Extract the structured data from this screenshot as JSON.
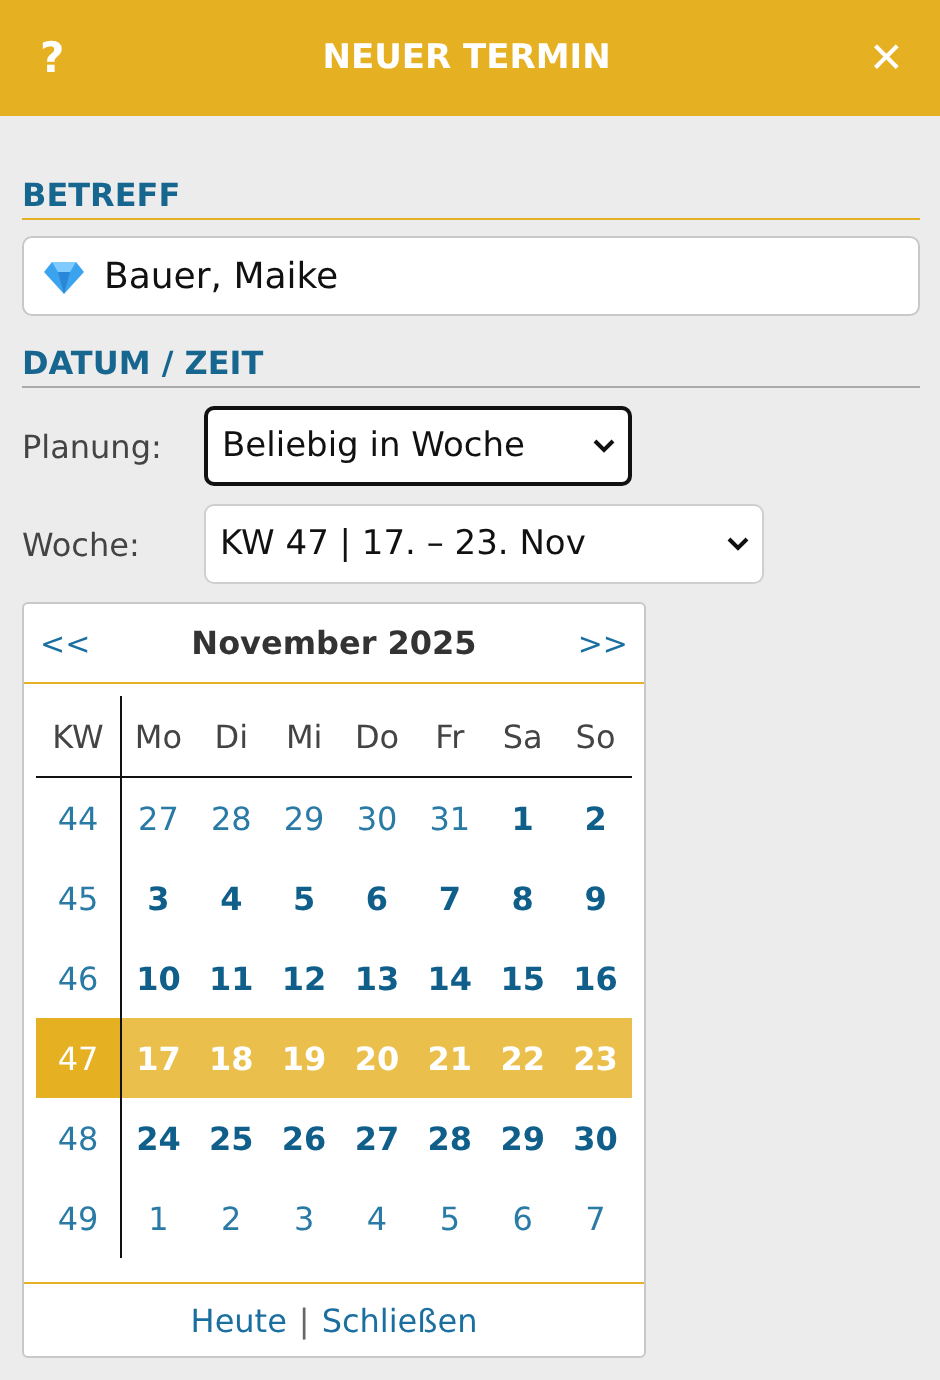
{
  "header": {
    "help": "?",
    "title": "NEUER TERMIN",
    "close": "✕"
  },
  "betreff": {
    "heading": "BETREFF",
    "value": "Bauer, Maike"
  },
  "datum": {
    "heading": "DATUM / ZEIT",
    "planung": {
      "label": "Planung:",
      "value": "Beliebig in Woche",
      "focused": true
    },
    "woche": {
      "label": "Woche:",
      "value": "KW 47 | 17. – 23. Nov",
      "focused": false
    }
  },
  "calendar": {
    "prev": "<<",
    "title": "November 2025",
    "next": ">>",
    "columns": [
      "KW",
      "Mo",
      "Di",
      "Mi",
      "Do",
      "Fr",
      "Sa",
      "So"
    ],
    "weeks": [
      {
        "kw": "44",
        "selected": false,
        "days": [
          {
            "day": "27",
            "in_month": false
          },
          {
            "day": "28",
            "in_month": false
          },
          {
            "day": "29",
            "in_month": false
          },
          {
            "day": "30",
            "in_month": false
          },
          {
            "day": "31",
            "in_month": false
          },
          {
            "day": "1",
            "in_month": true
          },
          {
            "day": "2",
            "in_month": true
          }
        ]
      },
      {
        "kw": "45",
        "selected": false,
        "days": [
          {
            "day": "3",
            "in_month": true
          },
          {
            "day": "4",
            "in_month": true
          },
          {
            "day": "5",
            "in_month": true
          },
          {
            "day": "6",
            "in_month": true
          },
          {
            "day": "7",
            "in_month": true
          },
          {
            "day": "8",
            "in_month": true
          },
          {
            "day": "9",
            "in_month": true
          }
        ]
      },
      {
        "kw": "46",
        "selected": false,
        "days": [
          {
            "day": "10",
            "in_month": true
          },
          {
            "day": "11",
            "in_month": true
          },
          {
            "day": "12",
            "in_month": true
          },
          {
            "day": "13",
            "in_month": true
          },
          {
            "day": "14",
            "in_month": true
          },
          {
            "day": "15",
            "in_month": true
          },
          {
            "day": "16",
            "in_month": true
          }
        ]
      },
      {
        "kw": "47",
        "selected": true,
        "days": [
          {
            "day": "17",
            "in_month": true
          },
          {
            "day": "18",
            "in_month": true
          },
          {
            "day": "19",
            "in_month": true
          },
          {
            "day": "20",
            "in_month": true
          },
          {
            "day": "21",
            "in_month": true
          },
          {
            "day": "22",
            "in_month": true
          },
          {
            "day": "23",
            "in_month": true
          }
        ]
      },
      {
        "kw": "48",
        "selected": false,
        "days": [
          {
            "day": "24",
            "in_month": true
          },
          {
            "day": "25",
            "in_month": true
          },
          {
            "day": "26",
            "in_month": true
          },
          {
            "day": "27",
            "in_month": true
          },
          {
            "day": "28",
            "in_month": true
          },
          {
            "day": "29",
            "in_month": true
          },
          {
            "day": "30",
            "in_month": true
          }
        ]
      },
      {
        "kw": "49",
        "selected": false,
        "days": [
          {
            "day": "1",
            "in_month": false
          },
          {
            "day": "2",
            "in_month": false
          },
          {
            "day": "3",
            "in_month": false
          },
          {
            "day": "4",
            "in_month": false
          },
          {
            "day": "5",
            "in_month": false
          },
          {
            "day": "6",
            "in_month": false
          },
          {
            "day": "7",
            "in_month": false
          }
        ]
      }
    ],
    "footer": {
      "today": "Heute",
      "separator": "|",
      "close": "Schließen"
    }
  }
}
